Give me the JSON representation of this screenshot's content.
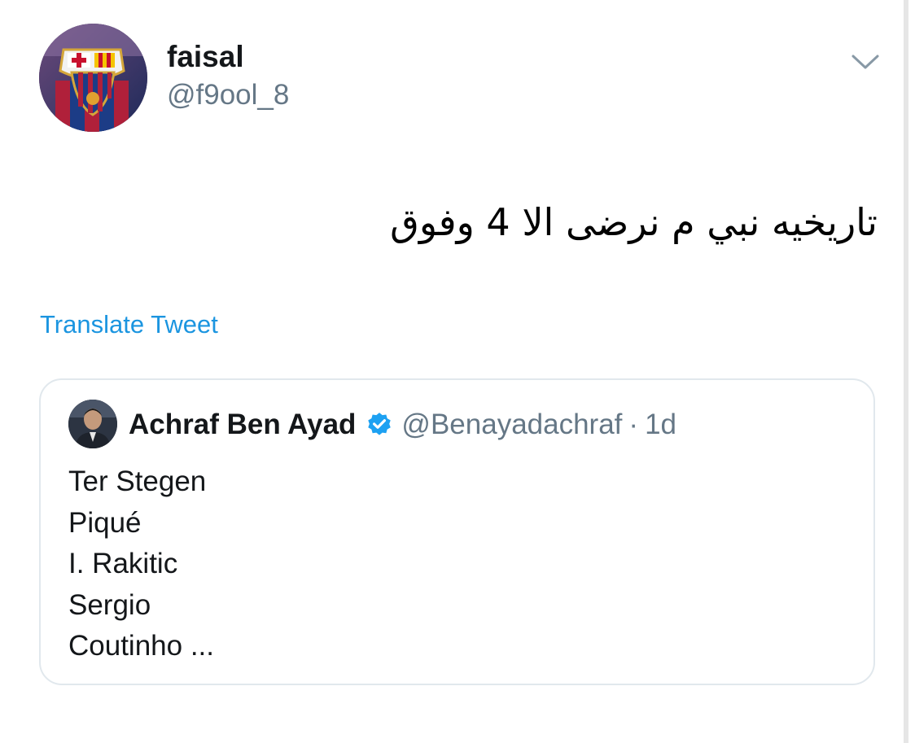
{
  "tweet": {
    "author": {
      "display_name": "faisal",
      "handle": "@f9ool_8",
      "avatar_icon": "fc-barcelona-crest-avatar"
    },
    "menu_icon": "chevron-down-icon",
    "text": "تاريخيه نبي م نرضى الا 4 وفوق",
    "translate_label": "Translate Tweet",
    "colors": {
      "link": "#1b95e0",
      "secondary_text": "#657786",
      "border": "#e1e8ed"
    }
  },
  "quoted_tweet": {
    "display_name": "Achraf Ben Ayad",
    "verified": true,
    "verified_icon": "verified-badge-icon",
    "handle": "@Benayadachraf",
    "separator": "·",
    "time": "1d",
    "lines": [
      "Ter Stegen",
      "Piqué",
      "I. Rakitic",
      "Sergio",
      "Coutinho ..."
    ]
  }
}
